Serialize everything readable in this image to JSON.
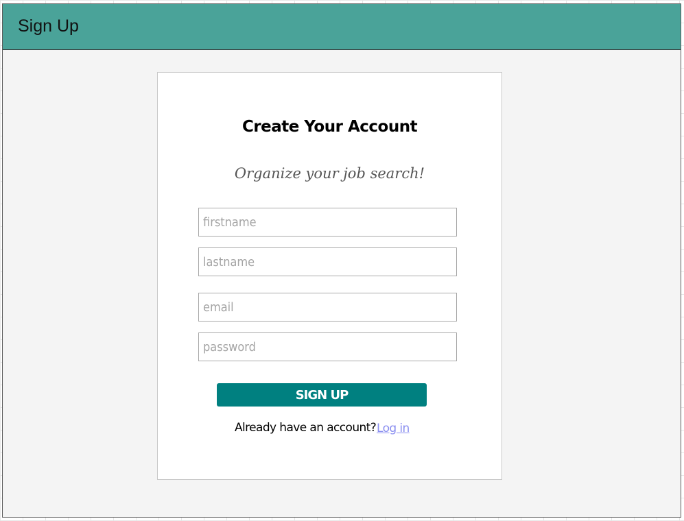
{
  "header": {
    "title": "Sign Up"
  },
  "card": {
    "title": "Create Your Account",
    "subtitle": "Organize your job search!",
    "fields": {
      "firstname_placeholder": "firstname",
      "lastname_placeholder": "lastname",
      "email_placeholder": "email",
      "password_placeholder": "password"
    },
    "signup_label": "SIGN UP",
    "already_text": "Already have an account?",
    "login_label": "Log in"
  },
  "colors": {
    "header_bg": "#4aa399",
    "button_bg": "#008080",
    "link": "#8a8ef0",
    "page_bg": "#f4f4f4"
  }
}
